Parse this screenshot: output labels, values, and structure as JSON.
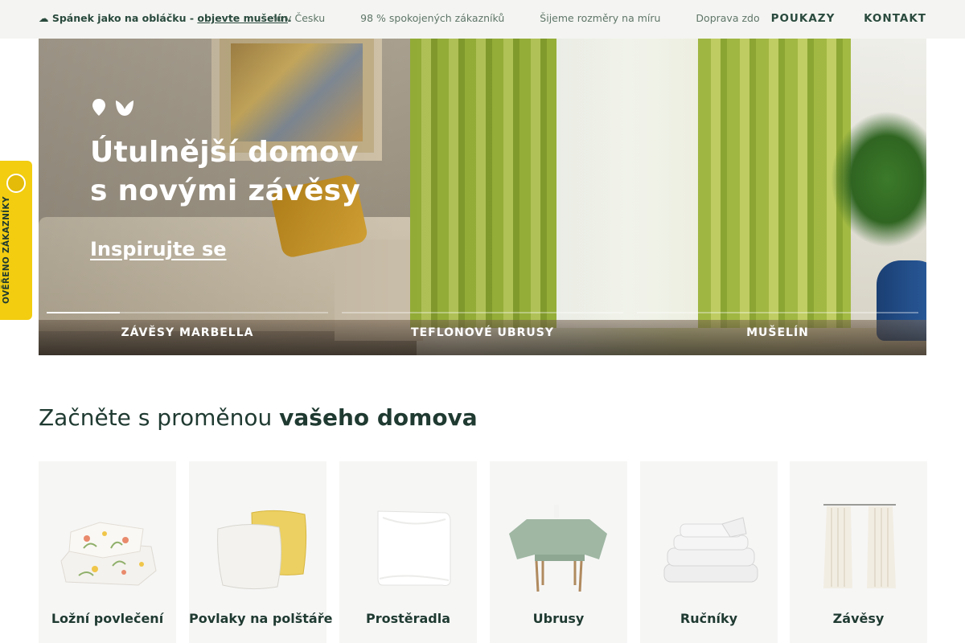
{
  "topbar": {
    "promo_text": "☁ Spánek jako na obláčku - ",
    "promo_link": "objevte mušelín",
    "promo_end": ".",
    "ticker": [
      "ubeno v Česku",
      "98 % spokojených zákazníků",
      "Šijeme rozměry na míru",
      "Doprava zdo"
    ],
    "nav": [
      "POUKAZY",
      "KONTAKT"
    ]
  },
  "hero": {
    "title_line1": "Útulnější domov",
    "title_line2": "s novými závěsy",
    "cta": "Inspirujte se",
    "slides": [
      {
        "label": "ZÁVĚSY MARBELLA",
        "progress": 0.26
      },
      {
        "label": "TEFLONOVÉ UBRUSY",
        "progress": 0
      },
      {
        "label": "MUŠELÍN",
        "progress": 0
      }
    ]
  },
  "badge": {
    "text": "OVĚŘENO ZÁKAZNÍKY"
  },
  "section": {
    "title_light": "Začněte s proměnou ",
    "title_bold": "vašeho domova"
  },
  "categories": [
    {
      "label": "Ložní povlečení",
      "icon": "floral-bedding-icon"
    },
    {
      "label": "Povlaky na polštáře",
      "icon": "pillow-covers-icon"
    },
    {
      "label": "Prostěradla",
      "icon": "fitted-sheet-icon"
    },
    {
      "label": "Ubrusy",
      "icon": "tablecloth-icon"
    },
    {
      "label": "Ručníky",
      "icon": "towels-icon"
    },
    {
      "label": "Závěsy",
      "icon": "curtains-icon"
    }
  ],
  "colors": {
    "brand_text": "#1f3a31",
    "topbar_bg": "#f4f5f2",
    "badge_yellow": "#f2cd10",
    "card_bg": "#f6f6f5"
  }
}
